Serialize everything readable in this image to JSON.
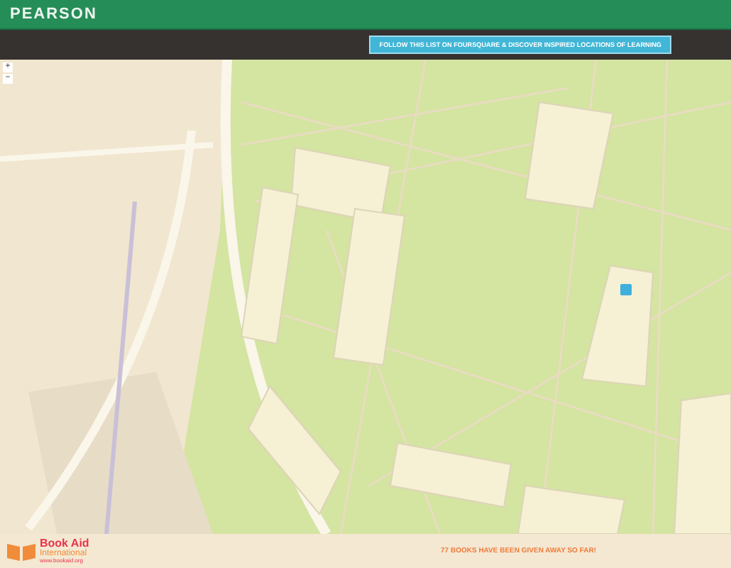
{
  "header": {
    "brand": "PEARSON"
  },
  "toolbar": {
    "follow_button": "FOLLOW THIS LIST ON FOURSQUARE & DISCOVER INSPIRED LOCATIONS OF LEARNING"
  },
  "map": {
    "zoom_controls": [
      "+",
      "−"
    ]
  },
  "footer": {
    "logo": {
      "name": "Book Aid",
      "subtitle": "International",
      "url": "www.bookaid.org"
    },
    "message": "77 BOOKS HAVE BEEN GIVEN AWAY SO FAR!"
  }
}
